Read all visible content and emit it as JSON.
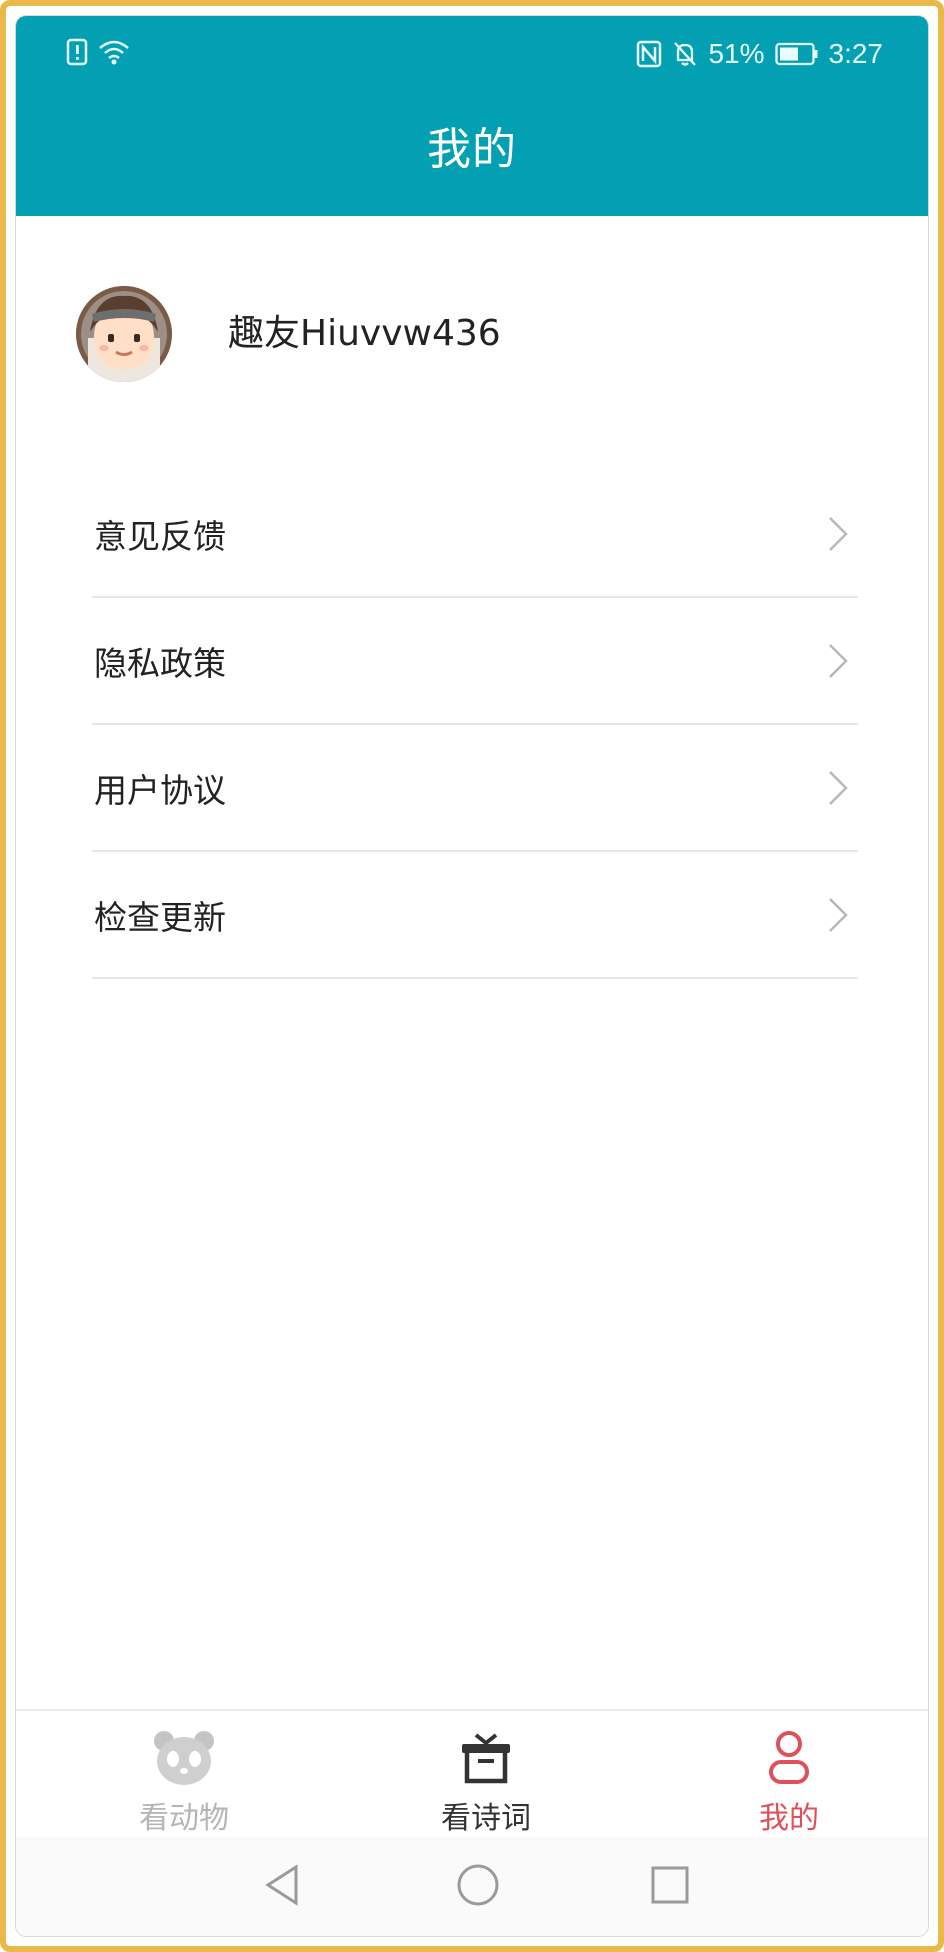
{
  "status_bar": {
    "battery_percent": "51%",
    "time": "3:27"
  },
  "header": {
    "title": "我的"
  },
  "profile": {
    "username": "趣友Hiuvvw436"
  },
  "menu": {
    "items": [
      {
        "label": "意见反馈"
      },
      {
        "label": "隐私政策"
      },
      {
        "label": "用户协议"
      },
      {
        "label": "检查更新"
      }
    ]
  },
  "tabbar": {
    "tabs": [
      {
        "label": "看动物",
        "icon": "panda-icon",
        "state": "inactive"
      },
      {
        "label": "看诗词",
        "icon": "gift-icon",
        "state": "default"
      },
      {
        "label": "我的",
        "icon": "user-icon",
        "state": "active"
      }
    ]
  },
  "colors": {
    "header_bg": "#03a0b3",
    "accent_active": "#e0505a",
    "text_primary": "#222222",
    "tab_inactive": "#b5b5b5",
    "tab_default": "#333333",
    "frame_border": "#e9b949"
  }
}
